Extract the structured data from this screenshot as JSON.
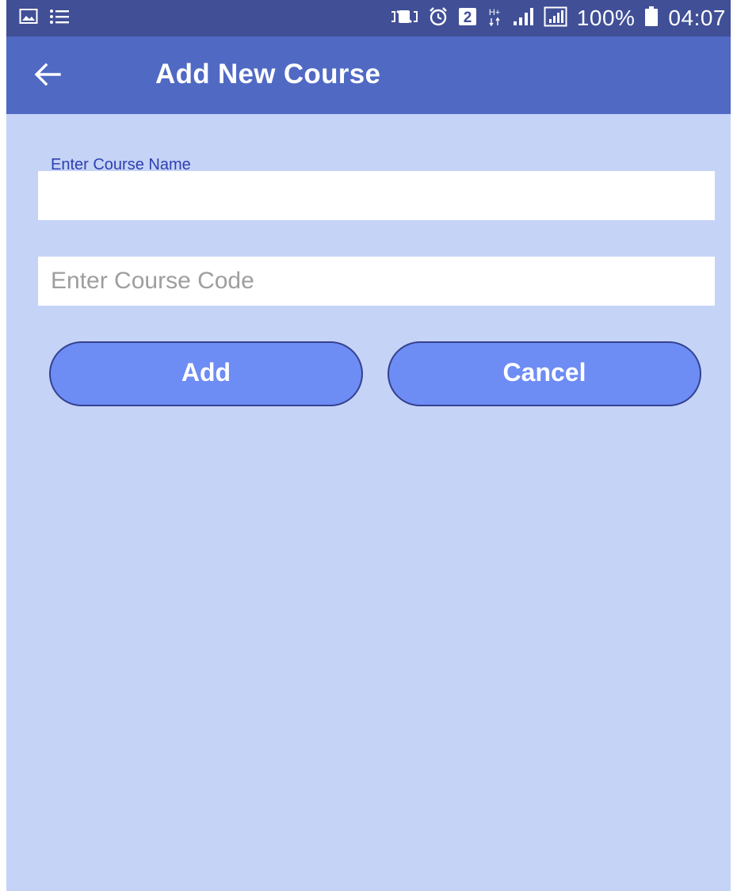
{
  "status_bar": {
    "battery_percent": "100%",
    "time": "04:07",
    "sim_badge": "2",
    "network_type": "H+"
  },
  "app_bar": {
    "title": "Add New Course"
  },
  "form": {
    "course_name": {
      "label": "Enter Course Name",
      "value": ""
    },
    "course_code": {
      "placeholder": "Enter Course Code",
      "value": ""
    }
  },
  "buttons": {
    "add_label": "Add",
    "cancel_label": "Cancel"
  },
  "colors": {
    "status_bar": "#404f96",
    "app_bar": "#5069c3",
    "background": "#c5d3f7",
    "button_fill": "#6d8cf4",
    "button_border": "#34418f",
    "label": "#2f3fb0"
  },
  "icons": {
    "back": "arrow-left-icon",
    "status_left": [
      "gallery-icon",
      "list-icon"
    ],
    "status_right": [
      "mute-vibrate-icon",
      "alarm-icon",
      "sim-2-icon",
      "network-hplus-icon",
      "signal-icon",
      "signal-boxed-icon",
      "battery-icon"
    ]
  }
}
